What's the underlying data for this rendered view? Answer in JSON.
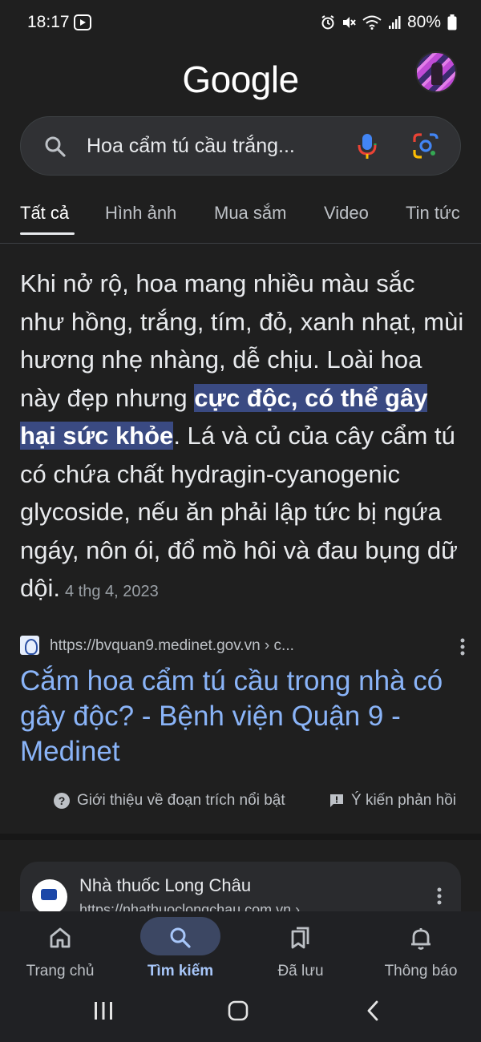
{
  "status_bar": {
    "time": "18:17",
    "battery": "80%"
  },
  "header": {
    "logo_text": "Google"
  },
  "search": {
    "query": "Hoa cẩm tú cầu trắng..."
  },
  "tabs": [
    {
      "label": "Tất cả",
      "active": true
    },
    {
      "label": "Hình ảnh",
      "active": false
    },
    {
      "label": "Mua sắm",
      "active": false
    },
    {
      "label": "Video",
      "active": false
    },
    {
      "label": "Tin tức",
      "active": false
    }
  ],
  "snippet": {
    "text_before": "Khi nở rộ, hoa mang nhiều màu sắc như hồng, trắng, tím, đỏ, xanh nhạt, mùi hương nhẹ nhàng, dễ chịu. Loài hoa này đẹp nhưng ",
    "highlight": "cực độc, có thể gây hại sức khỏe",
    "text_after": ". Lá và củ của cây cẩm tú có chứa chất hydragin-cyanogenic glycoside, nếu ăn phải lập tức bị ngứa ngáy, nôn ói, đổ mồ hôi và đau bụng dữ dội.",
    "date": "4 thg 4, 2023"
  },
  "source": {
    "url": "https://bvquan9.medinet.gov.vn › c...",
    "title": "Cắm hoa cẩm tú cầu trong nhà có gây độc? - Bệnh viện Quận 9 - Medinet"
  },
  "snippet_footer": {
    "about_label": "Giới thiệu về đoạn trích nổi bật",
    "feedback_label": "Ý kiến phản hồi"
  },
  "second_result": {
    "site_name": "Nhà thuốc Long Châu",
    "url": "https://nhathuoclongchau.com.vn ›"
  },
  "bottom_nav": [
    {
      "label": "Trang chủ",
      "icon": "home-icon",
      "active": false
    },
    {
      "label": "Tìm kiếm",
      "icon": "search-icon",
      "active": true
    },
    {
      "label": "Đã lưu",
      "icon": "bookmarks-icon",
      "active": false
    },
    {
      "label": "Thông báo",
      "icon": "bell-icon",
      "active": false
    }
  ],
  "colors": {
    "background": "#1f1f1f",
    "link": "#8ab4f8",
    "highlight": "#3a4a82",
    "active_nav": "#a8c7fa"
  }
}
